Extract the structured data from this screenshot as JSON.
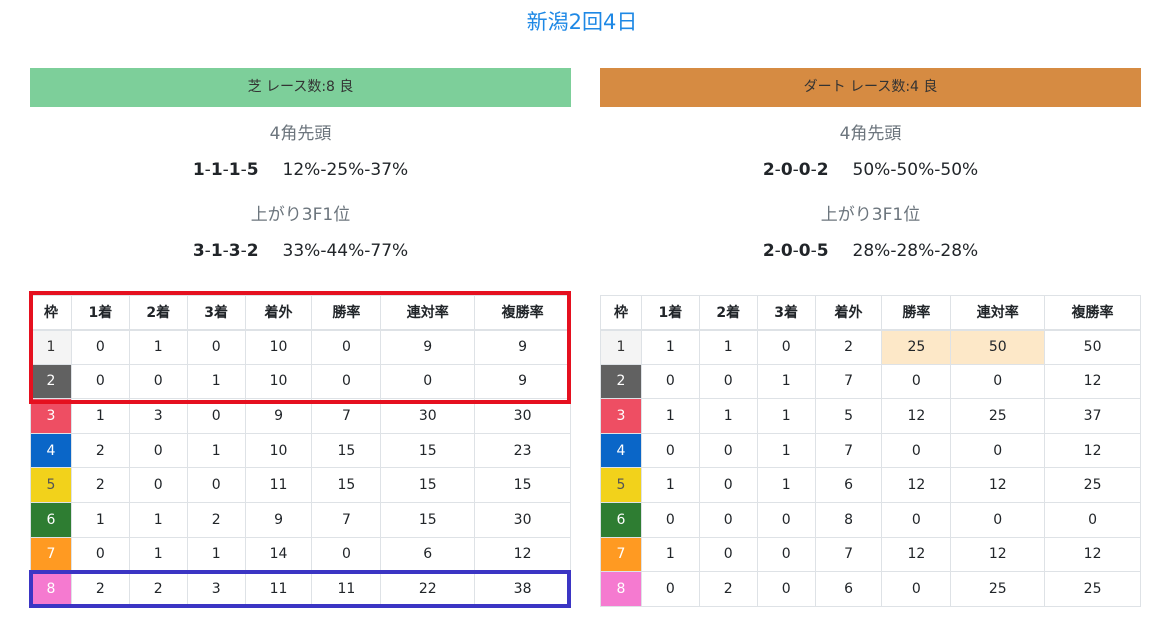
{
  "page_title": "新潟2回4日",
  "turf": {
    "banner": "芝 レース数:8 良",
    "corner_head": "4角先頭",
    "corner_counts": [
      "1",
      "1",
      "1",
      "5"
    ],
    "corner_rates": "12%-25%-37%",
    "last3f_head": "上がり3F1位",
    "last3f_counts": [
      "3",
      "1",
      "3",
      "2"
    ],
    "last3f_rates": "33%-44%-77%",
    "headers": [
      "枠",
      "1着",
      "2着",
      "3着",
      "着外",
      "勝率",
      "連対率",
      "複勝率"
    ],
    "rows": [
      [
        "1",
        "0",
        "1",
        "0",
        "10",
        "0",
        "9",
        "9"
      ],
      [
        "2",
        "0",
        "0",
        "1",
        "10",
        "0",
        "0",
        "9"
      ],
      [
        "3",
        "1",
        "3",
        "0",
        "9",
        "7",
        "30",
        "30"
      ],
      [
        "4",
        "2",
        "0",
        "1",
        "10",
        "15",
        "15",
        "23"
      ],
      [
        "5",
        "2",
        "0",
        "0",
        "11",
        "15",
        "15",
        "15"
      ],
      [
        "6",
        "1",
        "1",
        "2",
        "9",
        "7",
        "15",
        "30"
      ],
      [
        "7",
        "0",
        "1",
        "1",
        "14",
        "0",
        "6",
        "12"
      ],
      [
        "8",
        "2",
        "2",
        "3",
        "11",
        "11",
        "22",
        "38"
      ]
    ]
  },
  "dirt": {
    "banner": "ダート レース数:4 良",
    "corner_head": "4角先頭",
    "corner_counts": [
      "2",
      "0",
      "0",
      "2"
    ],
    "corner_rates": "50%-50%-50%",
    "last3f_head": "上がり3F1位",
    "last3f_counts": [
      "2",
      "0",
      "0",
      "5"
    ],
    "last3f_rates": "28%-28%-28%",
    "headers": [
      "枠",
      "1着",
      "2着",
      "3着",
      "着外",
      "勝率",
      "連対率",
      "複勝率"
    ],
    "rows": [
      [
        "1",
        "1",
        "1",
        "0",
        "2",
        "25",
        "50",
        "50"
      ],
      [
        "2",
        "0",
        "0",
        "1",
        "7",
        "0",
        "0",
        "12"
      ],
      [
        "3",
        "1",
        "1",
        "1",
        "5",
        "12",
        "25",
        "37"
      ],
      [
        "4",
        "0",
        "0",
        "1",
        "7",
        "0",
        "0",
        "12"
      ],
      [
        "5",
        "1",
        "0",
        "1",
        "6",
        "12",
        "12",
        "25"
      ],
      [
        "6",
        "0",
        "0",
        "0",
        "8",
        "0",
        "0",
        "0"
      ],
      [
        "7",
        "1",
        "0",
        "0",
        "7",
        "12",
        "12",
        "12"
      ],
      [
        "8",
        "0",
        "2",
        "0",
        "6",
        "0",
        "25",
        "25"
      ]
    ]
  },
  "colors": {
    "turf_banner": "#7dcf9a",
    "dirt_banner": "#d68b42",
    "highlight_cell": "#fde8c8",
    "red_box": "#e5101f",
    "blue_box": "#3b35c4"
  }
}
